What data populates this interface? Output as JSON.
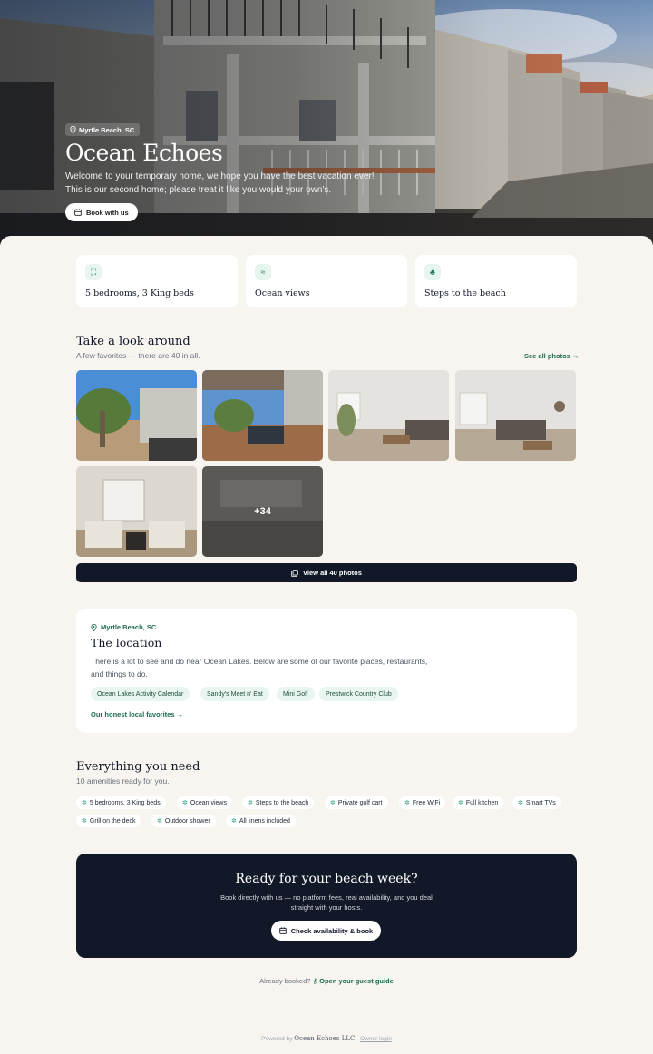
{
  "hero": {
    "location": "Myrtle Beach, SC",
    "title": "Ocean Echoes",
    "subtitle_line1": "Welcome to your temporary home, we hope you have the best vacation ever!",
    "subtitle_line2": "This is our second home; please treat it like you would your own's.",
    "book_label": "Book with us"
  },
  "features": [
    {
      "icon": "bed-icon",
      "label": "5 bedrooms, 3 King beds"
    },
    {
      "icon": "waves-icon",
      "label": "Ocean views"
    },
    {
      "icon": "palm-tree-icon",
      "label": "Steps to the beach"
    }
  ],
  "gallery": {
    "title": "Take a look around",
    "subtitle": "A few favorites — there are 40 in all.",
    "see_all": "See all photos →",
    "more_count": "+34",
    "view_all": "View all 40 photos"
  },
  "location": {
    "kicker": "Myrtle Beach, SC",
    "title": "The location",
    "description": "There is a lot to see and do near Ocean Lakes. Below are some of our favorite places, restaurants, and things to do.",
    "chips": [
      "Ocean Lakes Activity Calendar",
      "Sandy's Meet n' Eat",
      "Mini Golf",
      "Prestwick Country Club"
    ],
    "link": "Our honest local favorites →"
  },
  "amenities": {
    "title": "Everything you need",
    "subtitle": "10 amenities ready for you.",
    "items": [
      "5 bedrooms, 3 King beds",
      "Ocean views",
      "Steps to the beach",
      "Private golf cart",
      "Free WiFi",
      "Full kitchen",
      "Smart TVs",
      "Grill on the deck",
      "Outdoor shower",
      "All linens included"
    ]
  },
  "cta": {
    "title": "Ready for your beach week?",
    "text": "Book directly with us — no platform fees, real availability, and you deal straight with your hosts.",
    "button": "Check availability & book"
  },
  "guest": {
    "prefix": "Already booked?",
    "link": "Open your guest guide"
  },
  "footer": {
    "powered": "Powered by",
    "brand": "Ocean Echoes LLC",
    "sep": "·",
    "owner": "Owner login"
  },
  "colors": {
    "accent": "#1f6b50",
    "dark": "#111827",
    "background": "#f8f5f0"
  }
}
